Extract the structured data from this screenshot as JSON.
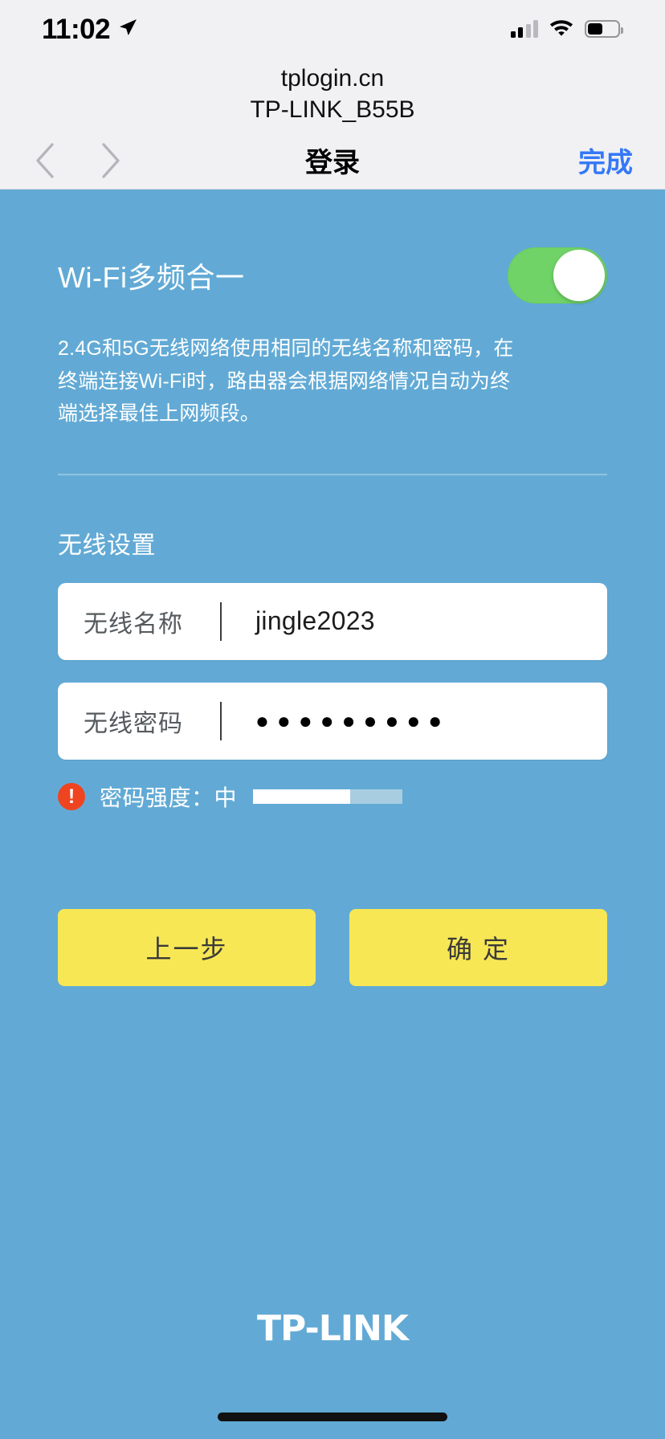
{
  "status_bar": {
    "time": "11:02",
    "location_icon": "location-arrow-icon",
    "cellular_icon": "cellular-signal-icon",
    "cellular_bars_filled": 2,
    "cellular_bars_total": 4,
    "wifi_icon": "wifi-icon",
    "battery_icon": "battery-icon",
    "battery_percent": 45
  },
  "browser": {
    "host": "tplogin.cn",
    "page_subtitle": "TP-LINK_B55B",
    "back_icon": "chevron-left-icon",
    "forward_icon": "chevron-right-icon",
    "title": "登录",
    "done_label": "完成",
    "done_color": "#3478f6"
  },
  "page": {
    "background_color": "#62aad5",
    "band_steering": {
      "title": "Wi-Fi多频合一",
      "toggle_state": "on",
      "toggle_on_color": "#6fd367",
      "description": "2.4G和5G无线网络使用相同的无线名称和密码，在终端连接Wi-Fi时，路由器会根据网络情况自动为终端选择最佳上网频段。"
    },
    "wireless_settings": {
      "section_title": "无线设置",
      "ssid_field": {
        "label": "无线名称",
        "value": "jingle2023"
      },
      "password_field": {
        "label": "无线密码",
        "value": "●●●●●●●●●",
        "char_count": 9
      },
      "strength": {
        "warn_icon": "exclamation-circle-icon",
        "warn_icon_color": "#ef4420",
        "label": "密码强度：",
        "level": "中",
        "percent": 65,
        "fill_color": "#ffffff",
        "track_color": "#a9cde0"
      }
    },
    "actions": {
      "back_label": "上一步",
      "confirm_label": "确 定",
      "button_color": "#f7e754"
    },
    "brand_logo": "TP-LINK"
  }
}
